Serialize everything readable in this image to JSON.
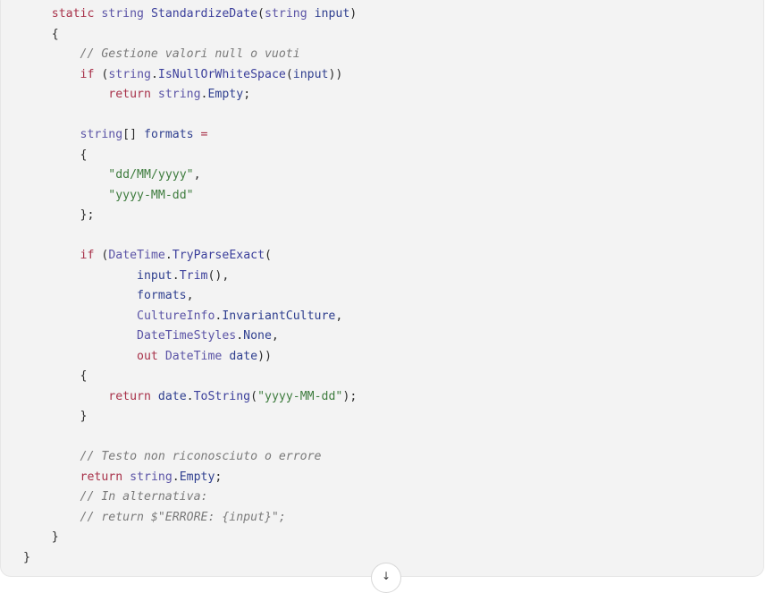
{
  "code_block": {
    "language": "csharp",
    "lines": [
      [
        [
          "static",
          "kw"
        ],
        [
          " ",
          "pn"
        ],
        [
          "string",
          "type"
        ],
        [
          " ",
          "pn"
        ],
        [
          "StandardizeDate",
          "fn"
        ],
        [
          "(",
          "pn"
        ],
        [
          "string",
          "type"
        ],
        [
          " ",
          "pn"
        ],
        [
          "input",
          "id"
        ],
        [
          ")",
          "pn"
        ]
      ],
      [
        [
          "{",
          "pn"
        ]
      ],
      [
        [
          "    ",
          "pn"
        ],
        [
          "// Gestione valori null o vuoti",
          "cm"
        ]
      ],
      [
        [
          "    ",
          "pn"
        ],
        [
          "if",
          "kw"
        ],
        [
          " (",
          "pn"
        ],
        [
          "string",
          "type"
        ],
        [
          ".",
          "pn"
        ],
        [
          "IsNullOrWhiteSpace",
          "fn"
        ],
        [
          "(",
          "pn"
        ],
        [
          "input",
          "id"
        ],
        [
          "))",
          "pn"
        ]
      ],
      [
        [
          "        ",
          "pn"
        ],
        [
          "return",
          "kw"
        ],
        [
          " ",
          "pn"
        ],
        [
          "string",
          "type"
        ],
        [
          ".",
          "pn"
        ],
        [
          "Empty",
          "id"
        ],
        [
          ";",
          "pn"
        ]
      ],
      [
        [
          "",
          "pn"
        ]
      ],
      [
        [
          "    ",
          "pn"
        ],
        [
          "string",
          "type"
        ],
        [
          "[] ",
          "pn"
        ],
        [
          "formats",
          "id"
        ],
        [
          " =",
          "kw"
        ]
      ],
      [
        [
          "    ",
          "pn"
        ],
        [
          "{",
          "pn"
        ]
      ],
      [
        [
          "        ",
          "pn"
        ],
        [
          "\"dd/MM/yyyy\"",
          "str"
        ],
        [
          ",",
          "pn"
        ]
      ],
      [
        [
          "        ",
          "pn"
        ],
        [
          "\"yyyy-MM-dd\"",
          "str"
        ]
      ],
      [
        [
          "    ",
          "pn"
        ],
        [
          "};",
          "pn"
        ]
      ],
      [
        [
          "",
          "pn"
        ]
      ],
      [
        [
          "    ",
          "pn"
        ],
        [
          "if",
          "kw"
        ],
        [
          " (",
          "pn"
        ],
        [
          "DateTime",
          "type"
        ],
        [
          ".",
          "pn"
        ],
        [
          "TryParseExact",
          "fn"
        ],
        [
          "(",
          "pn"
        ]
      ],
      [
        [
          "            ",
          "pn"
        ],
        [
          "input",
          "id"
        ],
        [
          ".",
          "pn"
        ],
        [
          "Trim",
          "fn"
        ],
        [
          "(),",
          "pn"
        ]
      ],
      [
        [
          "            ",
          "pn"
        ],
        [
          "formats",
          "id"
        ],
        [
          ",",
          "pn"
        ]
      ],
      [
        [
          "            ",
          "pn"
        ],
        [
          "CultureInfo",
          "type"
        ],
        [
          ".",
          "pn"
        ],
        [
          "InvariantCulture",
          "id"
        ],
        [
          ",",
          "pn"
        ]
      ],
      [
        [
          "            ",
          "pn"
        ],
        [
          "DateTimeStyles",
          "type"
        ],
        [
          ".",
          "pn"
        ],
        [
          "None",
          "id"
        ],
        [
          ",",
          "pn"
        ]
      ],
      [
        [
          "            ",
          "pn"
        ],
        [
          "out",
          "kw"
        ],
        [
          " ",
          "pn"
        ],
        [
          "DateTime",
          "type"
        ],
        [
          " ",
          "pn"
        ],
        [
          "date",
          "id"
        ],
        [
          "))",
          "pn"
        ]
      ],
      [
        [
          "    ",
          "pn"
        ],
        [
          "{",
          "pn"
        ]
      ],
      [
        [
          "        ",
          "pn"
        ],
        [
          "return",
          "kw"
        ],
        [
          " ",
          "pn"
        ],
        [
          "date",
          "id"
        ],
        [
          ".",
          "pn"
        ],
        [
          "ToString",
          "fn"
        ],
        [
          "(",
          "pn"
        ],
        [
          "\"yyyy-MM-dd\"",
          "str"
        ],
        [
          ");",
          "pn"
        ]
      ],
      [
        [
          "    ",
          "pn"
        ],
        [
          "}",
          "pn"
        ]
      ],
      [
        [
          "",
          "pn"
        ]
      ],
      [
        [
          "    ",
          "pn"
        ],
        [
          "// Testo non riconosciuto o errore",
          "cm"
        ]
      ],
      [
        [
          "    ",
          "pn"
        ],
        [
          "return",
          "kw"
        ],
        [
          " ",
          "pn"
        ],
        [
          "string",
          "type"
        ],
        [
          ".",
          "pn"
        ],
        [
          "Empty",
          "id"
        ],
        [
          ";",
          "pn"
        ]
      ],
      [
        [
          "    ",
          "pn"
        ],
        [
          "// In alternativa:",
          "cm"
        ]
      ],
      [
        [
          "    ",
          "pn"
        ],
        [
          "// return $\"ERRORE: {input}\";",
          "cm"
        ]
      ],
      [
        [
          "}",
          "pn"
        ]
      ]
    ],
    "outer_closing_brace": "}"
  },
  "scroll_button": {
    "icon": "arrow-down-icon",
    "glyph": "↓"
  }
}
